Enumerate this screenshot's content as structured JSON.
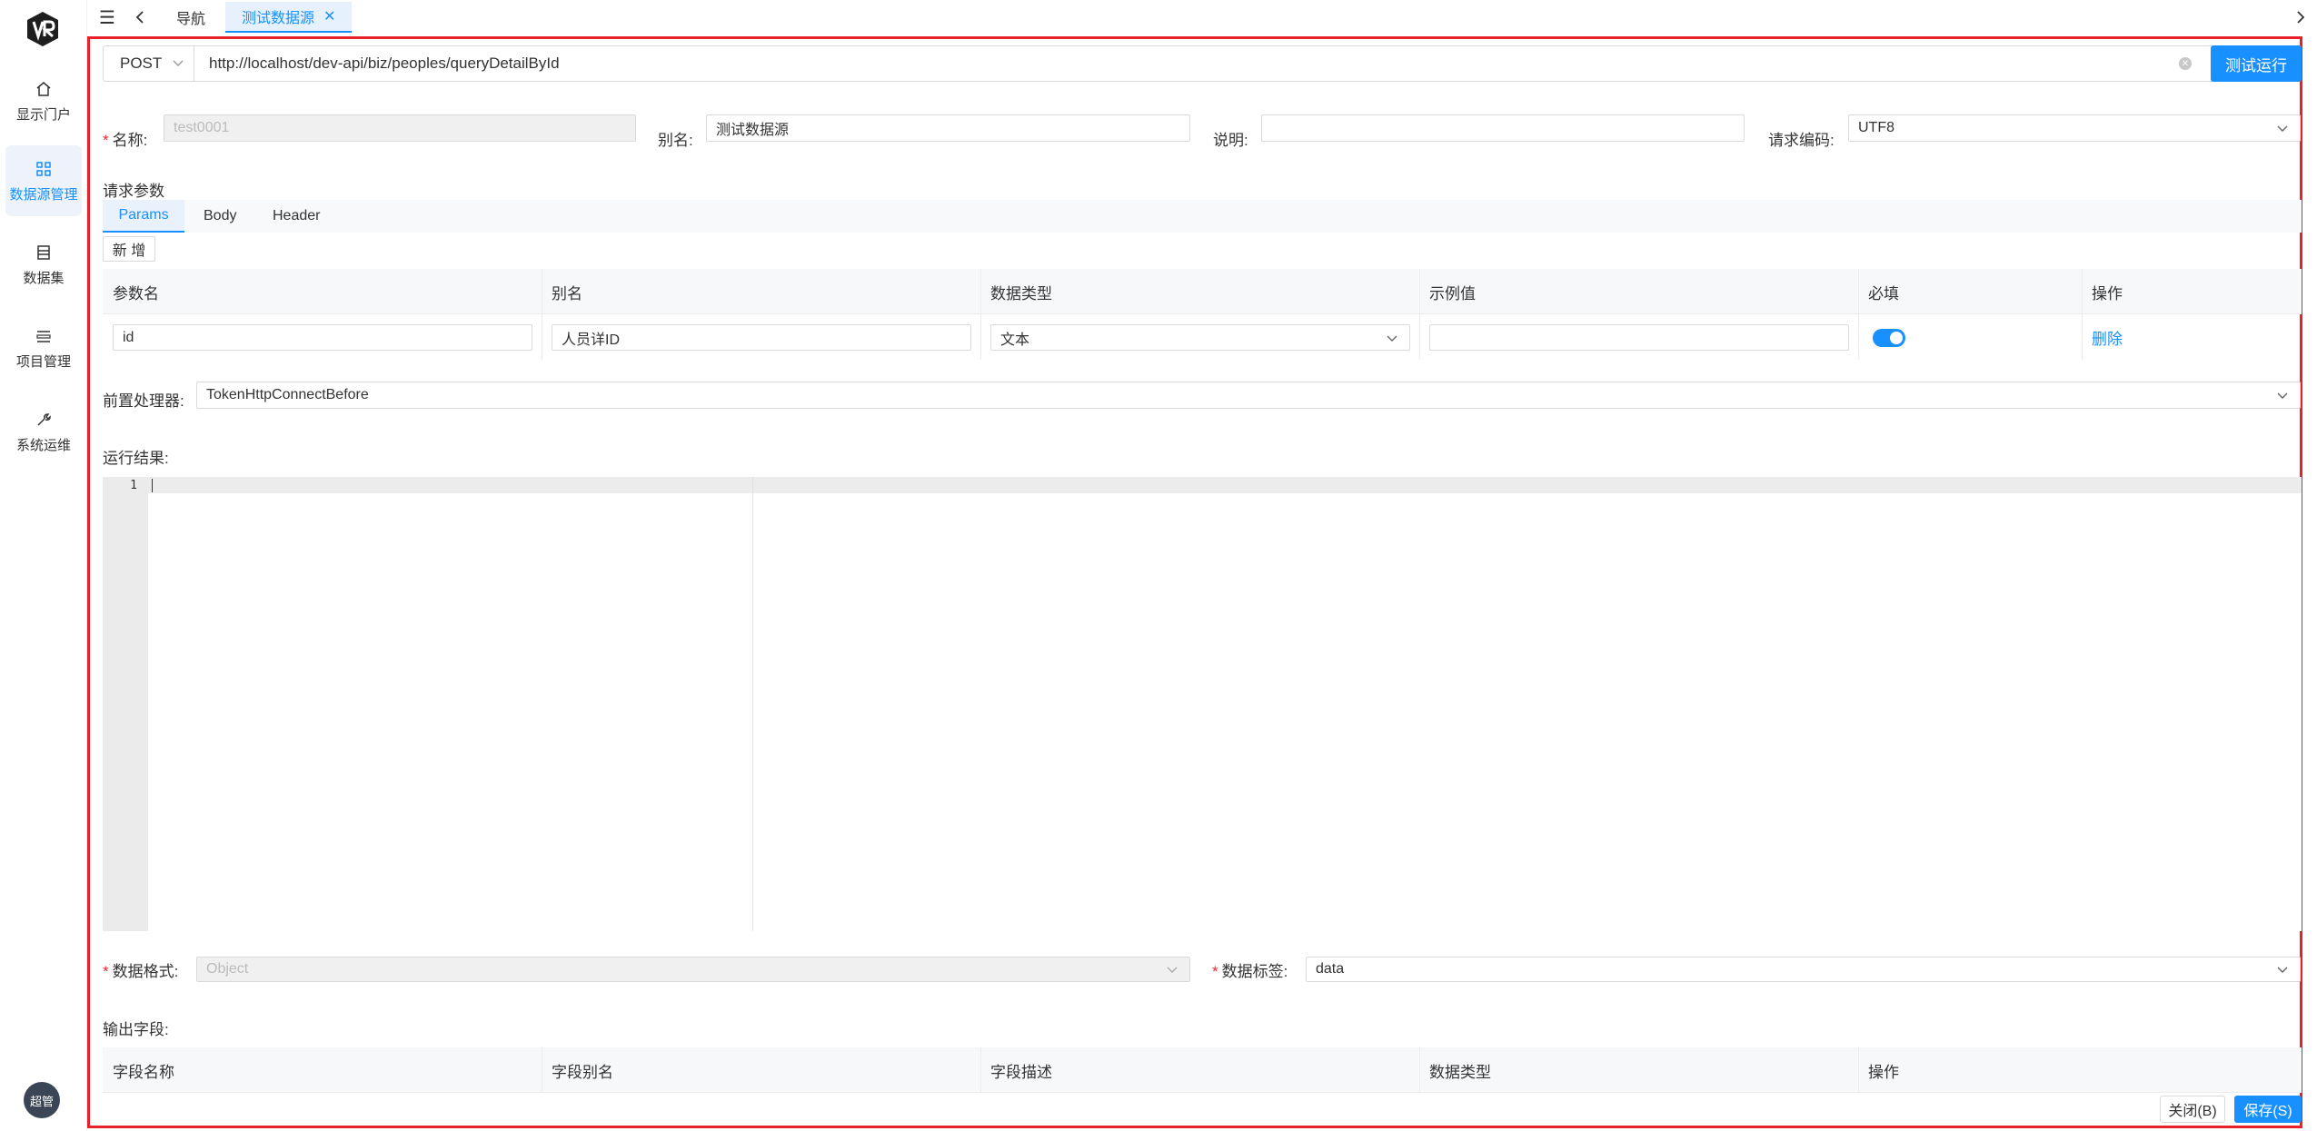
{
  "sidebar": {
    "logo_text": "VR",
    "items": [
      {
        "label": "显示门户",
        "icon": "home-icon"
      },
      {
        "label": "数据源管理",
        "icon": "grid-icon"
      },
      {
        "label": "数据集",
        "icon": "database-icon"
      },
      {
        "label": "项目管理",
        "icon": "project-icon"
      },
      {
        "label": "系统运维",
        "icon": "wrench-icon"
      }
    ],
    "active_index": 1,
    "avatar": "超管"
  },
  "topbar": {
    "tabs": [
      {
        "label": "导航"
      },
      {
        "label": "测试数据源"
      }
    ]
  },
  "request": {
    "method": "POST",
    "url": "http://localhost/dev-api/biz/peoples/queryDetailById",
    "run_button": "测试运行"
  },
  "form": {
    "name_label": "名称:",
    "name_value": "test0001",
    "alias_label": "别名:",
    "alias_value": "测试数据源",
    "desc_label": "说明:",
    "desc_value": "",
    "encoding_label": "请求编码:",
    "encoding_value": "UTF8"
  },
  "params": {
    "section_title": "请求参数",
    "tabs": [
      "Params",
      "Body",
      "Header"
    ],
    "add_button": "新 增",
    "columns": [
      "参数名",
      "别名",
      "数据类型",
      "示例值",
      "必填",
      "操作"
    ],
    "rows": [
      {
        "name": "id",
        "alias": "人员详ID",
        "type": "文本",
        "example": "",
        "required": true,
        "action": "删除"
      }
    ]
  },
  "preprocessor": {
    "label": "前置处理器:",
    "value": "TokenHttpConnectBefore"
  },
  "result": {
    "label": "运行结果:",
    "line_numbers": [
      "1"
    ]
  },
  "output": {
    "format_label": "数据格式:",
    "format_value": "Object",
    "tag_label": "数据标签:",
    "tag_value": "data",
    "fields_label": "输出字段:",
    "columns": [
      "字段名称",
      "字段别名",
      "字段描述",
      "数据类型",
      "操作"
    ]
  },
  "footer": {
    "close_button": "关闭(B)",
    "save_button": "保存(S)"
  },
  "colors": {
    "primary": "#1890ff",
    "highlight_border": "#e8202a"
  }
}
